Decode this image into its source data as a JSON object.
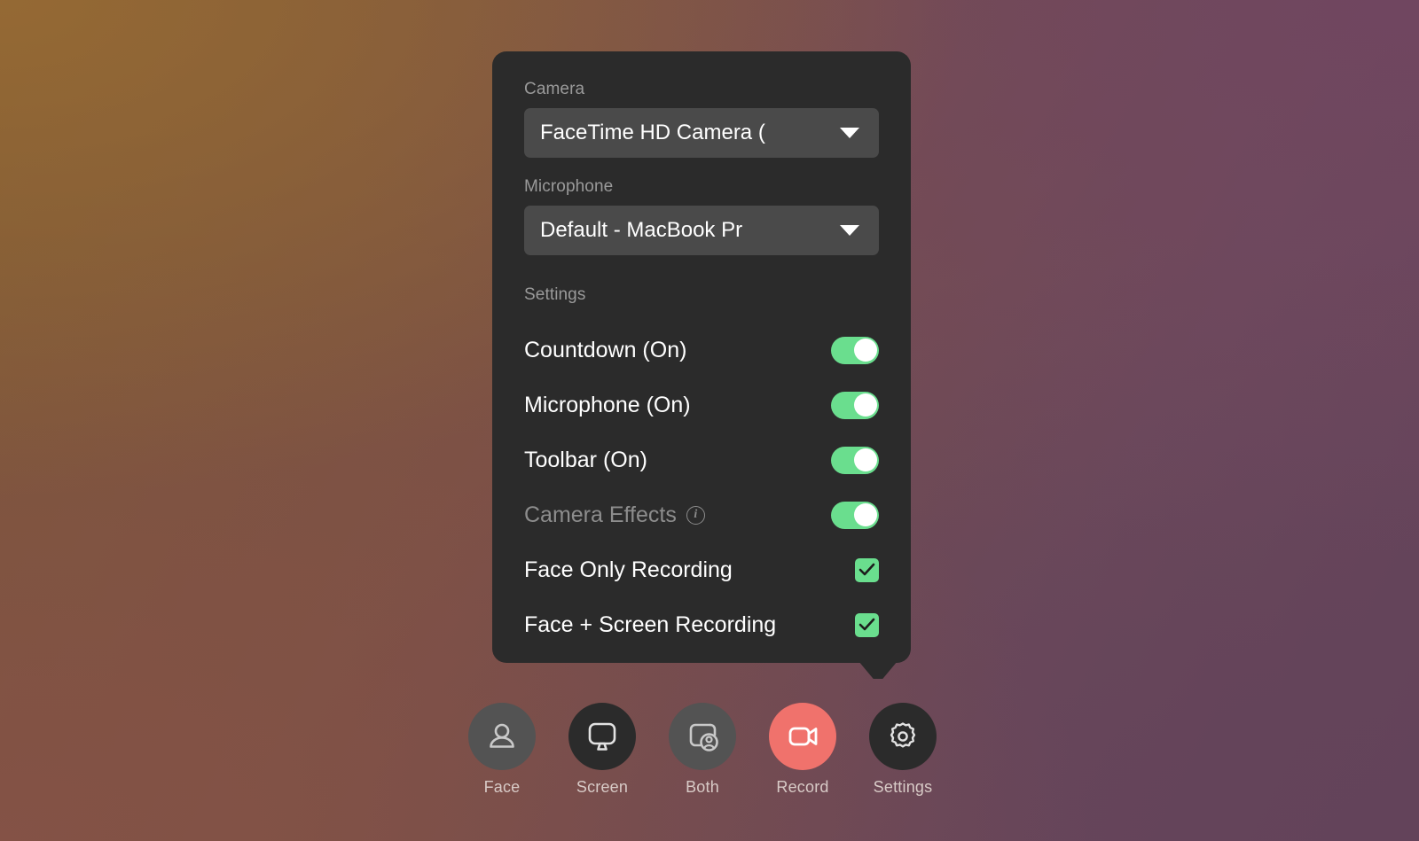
{
  "panel": {
    "camera": {
      "label": "Camera",
      "selected": "FaceTime HD Camera (",
      "caret_icon": "chevron-down-icon"
    },
    "microphone": {
      "label": "Microphone",
      "selected": "Default - MacBook Pr",
      "caret_icon": "chevron-down-icon"
    },
    "settings_label": "Settings",
    "toggles": [
      {
        "label": "Countdown (On)",
        "state": "on"
      },
      {
        "label": "Microphone (On)",
        "state": "on"
      },
      {
        "label": "Toolbar (On)",
        "state": "on"
      },
      {
        "label": "Camera Effects",
        "state": "on",
        "dim": true,
        "info_icon": "info-circle-icon",
        "info_glyph": "i"
      }
    ],
    "checkboxes": [
      {
        "label": "Face Only Recording",
        "checked": true
      },
      {
        "label": "Face + Screen Recording",
        "checked": true
      }
    ]
  },
  "toolbar": {
    "items": [
      {
        "label": "Face",
        "icon": "person-icon",
        "style": "light"
      },
      {
        "label": "Screen",
        "icon": "monitor-icon",
        "style": "dark"
      },
      {
        "label": "Both",
        "icon": "screen-and-person-icon",
        "style": "light"
      },
      {
        "label": "Record",
        "icon": "video-camera-icon",
        "style": "red"
      },
      {
        "label": "Settings",
        "icon": "gear-icon",
        "style": "dark"
      }
    ]
  },
  "colors": {
    "panel_bg": "#2b2b2b",
    "select_bg": "#4a4a4a",
    "accent_green": "#6ade8e",
    "record_red": "#f0726c",
    "label_muted": "#9a9a9a",
    "text": "#ffffff"
  }
}
